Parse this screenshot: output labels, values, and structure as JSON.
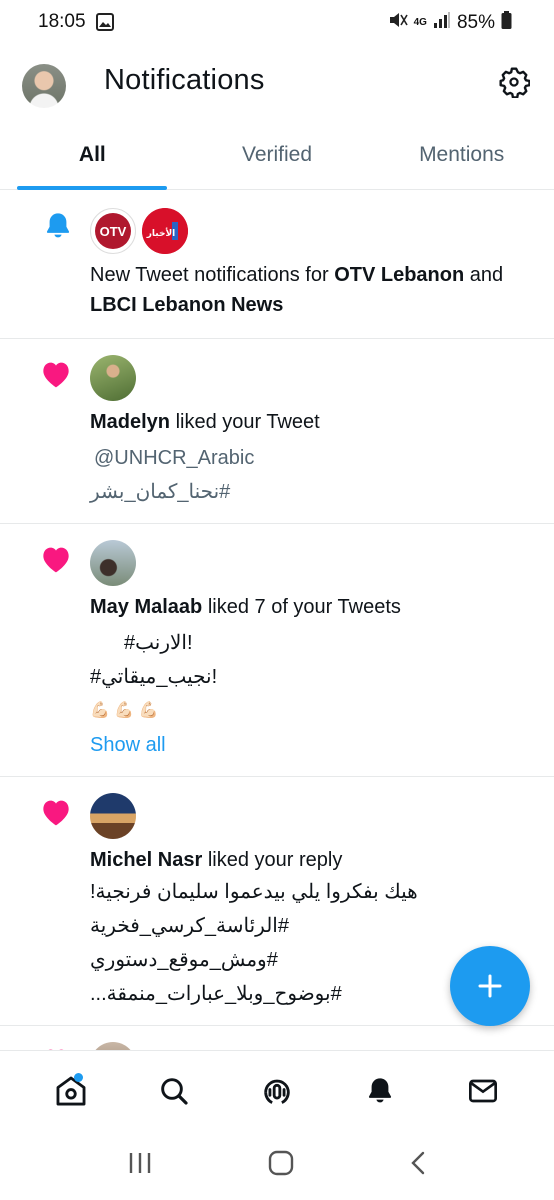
{
  "status_bar": {
    "time": "18:05",
    "network": "4G",
    "battery": "85%",
    "icons": [
      "gallery-icon",
      "mute-icon",
      "signal-icon",
      "battery-icon"
    ]
  },
  "header": {
    "title": "Notifications",
    "icons": [
      "avatar",
      "gear-icon"
    ]
  },
  "tabs": [
    {
      "label": "All",
      "active": true
    },
    {
      "label": "Verified",
      "active": false
    },
    {
      "label": "Mentions",
      "active": false
    }
  ],
  "notifications": [
    {
      "type": "bell",
      "avatars": [
        "OTV",
        "الأخبار LBCI"
      ],
      "prefix": "New Tweet notifications for ",
      "user1": "OTV Lebanon",
      "joiner": " and ",
      "user2": "LBCI Lebanon News"
    },
    {
      "type": "like",
      "user": "Madelyn",
      "action": " liked your Tweet",
      "snippets": [
        "@UNHCR_Arabic",
        "#نحنا_كمان_بشر"
      ]
    },
    {
      "type": "like",
      "user": "May Malaab",
      "action": " liked 7 of your Tweets",
      "snippets": [
        "#الارنب!",
        "#نجيب_ميقاتي!",
        "💪🏻 💪🏻 💪🏻"
      ],
      "show_all": "Show all"
    },
    {
      "type": "like",
      "user": "Michel Nasr",
      "action": " liked your reply",
      "snippets": [
        "هيك بفكروا يلي بيدعموا سليمان فرنجية!",
        "#الرئاسة_كرسي_فخرية",
        "#ومش_موقع_دستوري",
        "#بوضوح_وبلا_عبارات_منمقة..."
      ]
    }
  ],
  "colors": {
    "accent": "#1d9bf0",
    "like": "#f91880",
    "text": "#0f1419",
    "muted": "#536471"
  },
  "bottom_nav": [
    "home-icon",
    "search-icon",
    "spaces-icon",
    "notifications-icon",
    "messages-icon"
  ]
}
